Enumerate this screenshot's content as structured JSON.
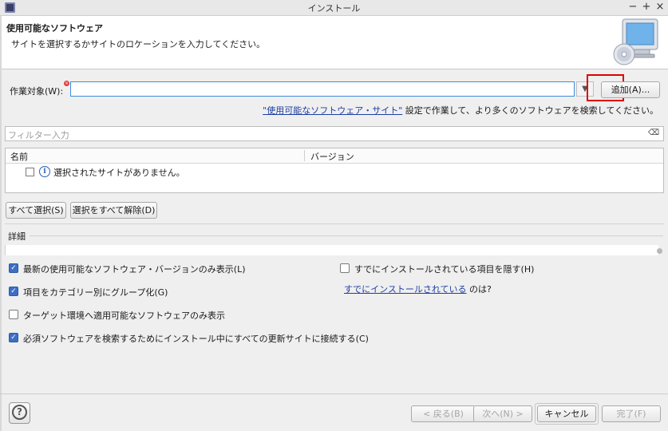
{
  "window": {
    "title": "インストール",
    "controls": [
      "−",
      "+",
      "×"
    ]
  },
  "header": {
    "title": "使用可能なソフトウェア",
    "description": "サイトを選択するかサイトのロケーションを入力してください。",
    "image_icon": "install-cd-monitor-icon"
  },
  "work_with": {
    "label": "作業対象(W):",
    "value": "",
    "add_button": "追加(A)..."
  },
  "hint": {
    "link": "\"使用可能なソフトウェア・サイト\"",
    "text": " 設定で作業して、より多くのソフトウェアを検索してください。"
  },
  "filter": {
    "placeholder": "フィルター入力"
  },
  "table": {
    "columns": [
      "名前",
      "バージョン"
    ],
    "rows": [
      {
        "checked": false,
        "icon": "info-icon",
        "text": "選択されたサイトがありません。"
      }
    ]
  },
  "selection_buttons": {
    "select_all": "すべて選択(S)",
    "deselect_all": "選択をすべて解除(D)"
  },
  "details": {
    "label": "詳細"
  },
  "options": {
    "show_latest": {
      "label": "最新の使用可能なソフトウェア・バージョンのみ表示(L)",
      "checked": true
    },
    "group_by_category": {
      "label": "項目をカテゴリー別にグループ化(G)",
      "checked": true
    },
    "target_env_only": {
      "label": "ターゲット環境へ適用可能なソフトウェアのみ表示",
      "checked": false
    },
    "contact_all_sites": {
      "label": "必須ソフトウェアを検索するためにインストール中にすべての更新サイトに接続する(C)",
      "checked": true
    },
    "hide_installed": {
      "label": "すでにインストールされている項目を隠す(H)",
      "checked": false
    },
    "already_installed": {
      "link": "すでにインストールされている",
      "suffix": " のは?"
    }
  },
  "footer": {
    "help_icon": "help-icon",
    "back": "< 戻る(B)",
    "next": "次へ(N) >",
    "cancel": "キャンセル",
    "finish": "完了(F)"
  },
  "colors": {
    "accent": "#3c6fc4",
    "link": "#1f3fa3",
    "highlight": "#e00000"
  }
}
